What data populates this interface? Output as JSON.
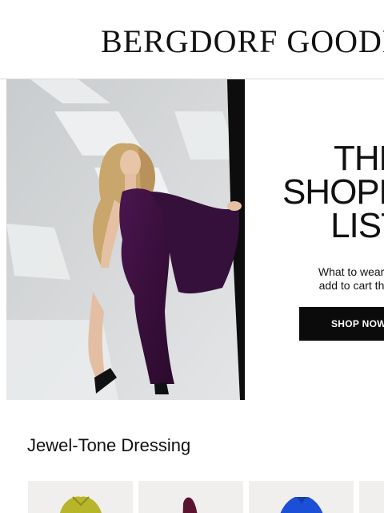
{
  "header": {
    "logo_text": "BERGDORF GOODMAN"
  },
  "hero": {
    "headline_lines": [
      "THE",
      "SHOPP",
      "LIST"
    ],
    "subcopy_lines": [
      "What to wear, ca",
      "add to cart this s"
    ],
    "button_label": "SHOP NOW",
    "image_alt": "model-in-purple-one-shoulder-gown"
  },
  "section": {
    "title": "Jewel-Tone Dressing"
  },
  "products": [
    {
      "color": "#b7b52a"
    },
    {
      "color": "#5a1430"
    },
    {
      "color": "#1a4fd6"
    },
    {
      "color": "#e8e6e2"
    }
  ],
  "colors": {
    "button_bg": "#0b0b0b",
    "gown": "#3a0f3c",
    "card_bg": "#f0efed"
  }
}
